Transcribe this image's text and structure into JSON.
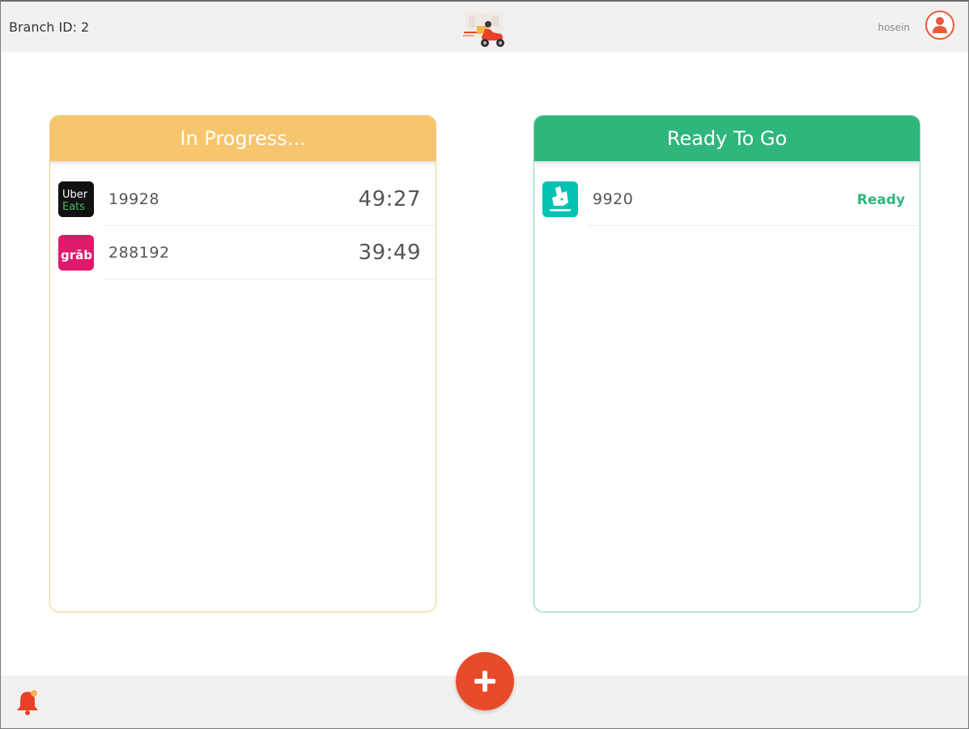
{
  "header": {
    "branch_label": "Branch ID: 2",
    "username": "hosein",
    "logo_icon": "delivery-scooter-logo",
    "avatar_icon": "user-icon"
  },
  "colors": {
    "in_progress": "#f7c56d",
    "ready": "#2fb67c",
    "accent": "#e84a2c",
    "bar": "#f3f1ef"
  },
  "panels": {
    "in_progress": {
      "title": "In Progress...",
      "orders": [
        {
          "platform": "Uber Eats",
          "platform_icon": "ubereats-logo",
          "id": "19928",
          "time": "49:27"
        },
        {
          "platform": "Grab",
          "platform_icon": "grab-logo",
          "id": "288192",
          "time": "39:49"
        }
      ]
    },
    "ready": {
      "title": "Ready To Go",
      "orders": [
        {
          "platform": "Deliveroo",
          "platform_icon": "deliveroo-logo",
          "id": "9920",
          "status": "Ready"
        }
      ]
    }
  },
  "footer": {
    "bell_icon": "bell-icon",
    "add_icon": "plus-icon"
  }
}
